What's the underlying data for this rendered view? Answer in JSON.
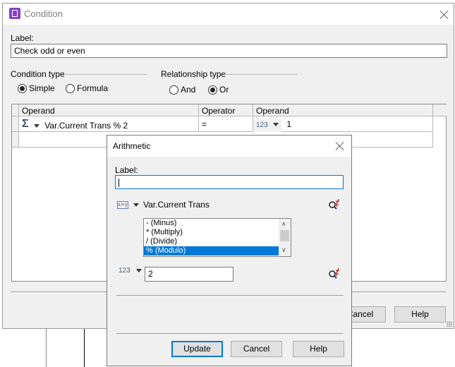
{
  "condition_window": {
    "title": "Condition",
    "label_caption": "Label:",
    "label_value": "Check odd or even",
    "condition_type": {
      "caption": "Condition type",
      "options": [
        {
          "label": "Simple",
          "selected": true
        },
        {
          "label": "Formula",
          "selected": false
        }
      ]
    },
    "relationship_type": {
      "caption": "Relationship type",
      "options": [
        {
          "label": "And",
          "selected": false
        },
        {
          "label": "Or",
          "selected": true
        }
      ]
    },
    "grid": {
      "columns": [
        "Operand",
        "Operator",
        "Operand"
      ],
      "rows": [
        {
          "left_icon": "sigma-icon",
          "left_operand": "Var.Current Trans % 2",
          "operator": "=",
          "right_icon": "123",
          "right_operand": "1"
        }
      ]
    },
    "buttons": {
      "cancel": "Cancel",
      "help": "Help"
    }
  },
  "arithmetic_dialog": {
    "title": "Arithmetic",
    "label_caption": "Label:",
    "label_value": "",
    "left_operand": {
      "icon": "variable-icon",
      "value": "Var.Current Trans"
    },
    "operators": {
      "items": [
        "- (Minus)",
        "* (Multiply)",
        "/ (Divide)",
        "% (Modulo)"
      ],
      "selected": "% (Modulo)"
    },
    "right_operand": {
      "icon_text": "123",
      "value": "2"
    },
    "buttons": {
      "update": "Update",
      "cancel": "Cancel",
      "help": "Help"
    }
  }
}
